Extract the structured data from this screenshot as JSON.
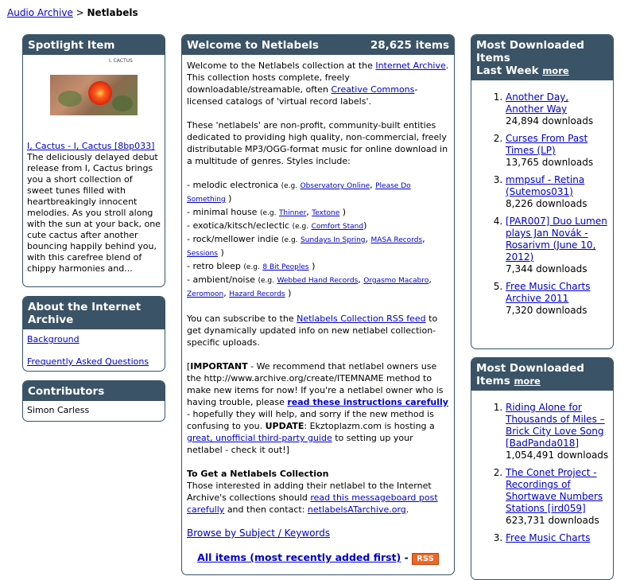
{
  "breadcrumb": {
    "parent": "Audio Archive",
    "sep": " > ",
    "current": "Netlabels"
  },
  "spotlight": {
    "title": "Spotlight Item",
    "thumb_tag": "I, CACTUS",
    "link": "I, Cactus - I, Cactus [8bp033]",
    "desc": "The deliciously delayed debut release from I, Cactus brings you a short collection of sweet tunes filled with heartbreakingly innocent melodies. As you stroll along with the sun at your back, one cute cactus after another bouncing happily behind you, with this carefree blend of chippy harmonies and..."
  },
  "about": {
    "title": "About the Internet Archive",
    "links": [
      "Background",
      "Frequently Asked Questions"
    ]
  },
  "contributors": {
    "title": "Contributors",
    "names": [
      "Simon Carless"
    ]
  },
  "welcome": {
    "title": "Welcome to Netlabels",
    "count": "28,625 items",
    "p1_a": "Welcome to the Netlabels collection at the",
    "p1_link1": "Internet Archive",
    "p1_b": ". This collection hosts complete, freely downloadable/streamable, often",
    "p1_link2": "Creative Commons",
    "p1_c": "-licensed catalogs of 'virtual record labels'.",
    "p2": "These 'netlabels' are non-profit, community-built entities dedicated to providing high quality, non-commercial, freely distributable MP3/OGG-format music for online download in a multitude of genres. Styles include:",
    "styles": [
      {
        "name": "- melodic electronica",
        "eg": "(e.g.",
        "links": [
          "Observatory Online",
          "Please Do Something"
        ]
      },
      {
        "name": "- minimal house",
        "eg": "(e.g.",
        "links": [
          "Thinner",
          "Textone"
        ]
      },
      {
        "name": "- exotica/kitsch/eclectic",
        "eg": "(e.g.",
        "links": [
          "Comfort Stand"
        ]
      },
      {
        "name": "- rock/mellower indie",
        "eg": "(e.g.",
        "links": [
          "Sundays In Spring",
          "MASA Records",
          "Sessions"
        ]
      },
      {
        "name": "- retro bleep",
        "eg": "(e.g.",
        "links": [
          "8 Bit Peoples"
        ]
      },
      {
        "name": "- ambient/noise",
        "eg": "(e.g.",
        "links": [
          "Webbed Hand Records",
          "Orgasmo Macabro",
          "Zeromoon",
          "Hazard Records"
        ]
      }
    ],
    "p3_a": "You can subscribe to the",
    "p3_link": "Netlabels Collection RSS feed",
    "p3_b": "to get dynamically updated info on new netlabel collection-specific uploads.",
    "p4_open": "[",
    "p4_bold": "IMPORTANT",
    "p4_a": " - We recommend that netlabel owners use the http://www.archive.org/create/ITEMNAME method to make new items for now! If you're a netlabel owner who is having trouble, please",
    "p4_link": "read these instructions carefully",
    "p4_b": "- hopefully they will help, and sorry if the new method is confusing to you.",
    "p4_bold2": "UPDATE",
    "p4_c": ": Ekztoplazm.com is hosting a",
    "p4_link2": "great, unofficial third-party guide",
    "p4_d": "to setting up your netlabel - check it out!]",
    "get_title": "To Get a Netlabels Collection",
    "p5_a": "Those interested in adding their netlabel to the Internet Archive's collections should",
    "p5_link": "read this messageboard post carefully",
    "p5_b": "and then contact:",
    "p5_email": "netlabelsATarchive.org",
    "p5_c": ".",
    "browse": "Browse by Subject / Keywords",
    "all_items": "All items (most recently added first)",
    "dash": " - ",
    "rss": "RSS"
  },
  "most_week": {
    "title_line1": "Most Downloaded Items",
    "title_line2": "Last Week",
    "more": "more",
    "items": [
      {
        "title": "Another Day, Another Way",
        "downloads": "24,894 downloads"
      },
      {
        "title": "Curses From Past Times (LP)",
        "downloads": "13,765 downloads"
      },
      {
        "title": "mmpsuf - Retina (Sutemos031)",
        "downloads": "8,226 downloads"
      },
      {
        "title": "[PAR007] Duo Lumen plays Jan Novák - Rosarivm (June 10, 2012)",
        "downloads": "7,344 downloads"
      },
      {
        "title": "Free Music Charts Archive 2011",
        "downloads": "7,320 downloads"
      }
    ]
  },
  "most_all": {
    "title": "Most Downloaded Items",
    "more": "more",
    "items": [
      {
        "title": "Riding Alone for Thousands of Miles – Brick City Love Song [BadPanda018]",
        "downloads": "1,054,491 downloads"
      },
      {
        "title": "The Conet Project - Recordings of Shortwave Numbers Stations [ird059]",
        "downloads": "623,731 downloads"
      },
      {
        "title": "Free Music Charts",
        "downloads": ""
      }
    ]
  }
}
